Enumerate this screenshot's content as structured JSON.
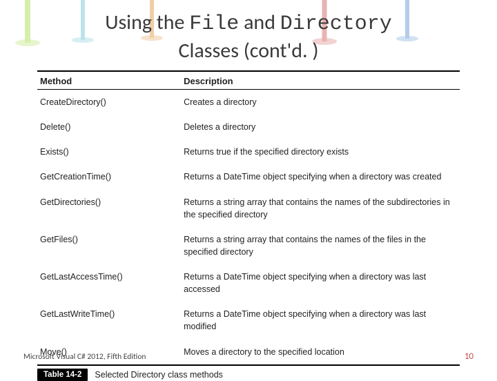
{
  "title": {
    "pre": "Using the ",
    "code1": "File",
    "mid": " and ",
    "code2": "Directory",
    "post": " Classes (cont'd. )"
  },
  "table": {
    "head_method": "Method",
    "head_desc": "Description",
    "rows": [
      {
        "m": "CreateDirectory()",
        "d": "Creates a directory"
      },
      {
        "m": "Delete()",
        "d": "Deletes a directory"
      },
      {
        "m": "Exists()",
        "d": "Returns true if the specified directory exists"
      },
      {
        "m": "GetCreationTime()",
        "d": "Returns a DateTime object specifying when a directory was created"
      },
      {
        "m": "GetDirectories()",
        "d": "Returns a string array that contains the names of the subdirectories in the specified directory"
      },
      {
        "m": "GetFiles()",
        "d": "Returns a string array that contains the names of the files in the specified directory"
      },
      {
        "m": "GetLastAccessTime()",
        "d": "Returns a DateTime object specifying when a directory was last accessed"
      },
      {
        "m": "GetLastWriteTime()",
        "d": "Returns a DateTime object specifying when a directory was last modified"
      },
      {
        "m": "Move()",
        "d": "Moves a directory to the specified location"
      }
    ]
  },
  "caption": {
    "label": "Table 14-2",
    "text": "Selected Directory class methods"
  },
  "footer": {
    "left": "Microsoft Visual C# 2012, Fifth Edition",
    "right": "10"
  }
}
